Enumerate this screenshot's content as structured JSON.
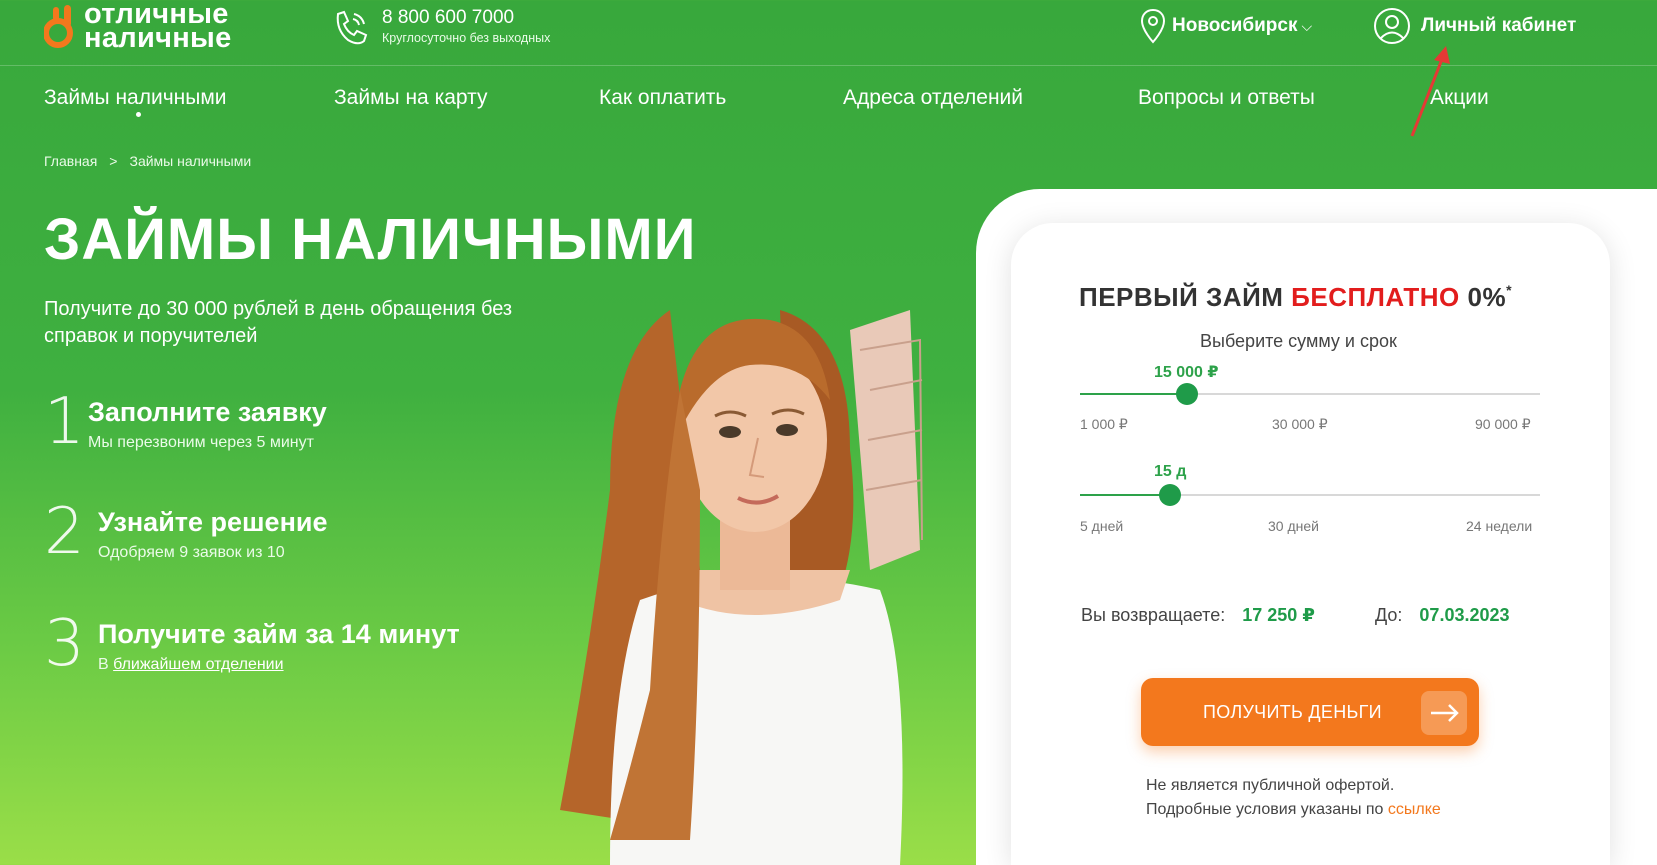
{
  "brand": {
    "line1": "отличные",
    "line2": "наличные"
  },
  "phone": {
    "number": "8 800 600 7000",
    "hours": "Круглосуточно без выходных"
  },
  "city": {
    "name": "Новосибирск",
    "icon": "location-pin-icon"
  },
  "cabinet": {
    "label": "Личный кабинет",
    "icon": "user-icon"
  },
  "nav": {
    "items": [
      {
        "label": "Займы наличными"
      },
      {
        "label": "Займы на карту"
      },
      {
        "label": "Как оплатить"
      },
      {
        "label": "Адреса отделений"
      },
      {
        "label": "Вопросы и ответы"
      },
      {
        "label": "Акции"
      }
    ]
  },
  "breadcrumb": {
    "home": "Главная",
    "sep": ">",
    "current": "Займы наличными"
  },
  "hero": {
    "title": "ЗАЙМЫ НАЛИЧНЫМИ",
    "subtitle": "Получите до 30 000 рублей в день обращения без справок и поручителей"
  },
  "steps": [
    {
      "num": "1",
      "title": "Заполните заявку",
      "desc": "Мы перезвоним через 5 минут"
    },
    {
      "num": "2",
      "title": "Узнайте решение",
      "desc": "Одобряем 9 заявок из 10"
    },
    {
      "num": "3",
      "title": "Получите займ за 14 минут",
      "desc_prefix": "В",
      "desc_link": "ближайшем отделении"
    }
  ],
  "calculator": {
    "title_prefix": "ПЕРВЫЙ ЗАЙМ",
    "title_red": "БЕСПЛАТНО",
    "title_suffix": "0%",
    "title_mark": "*",
    "subtitle": "Выберите сумму и срок",
    "amount": {
      "value": "15 000 ₽",
      "fraction": 0.233,
      "ticks": [
        "1 000 ₽",
        "30 000 ₽",
        "90 000 ₽"
      ]
    },
    "term": {
      "value": "15 д",
      "fraction": 0.195,
      "ticks": [
        "5 дней",
        "30 дней",
        "24 недели"
      ]
    },
    "return_label": "Вы возвращаете:",
    "return_value": "17 250 ₽",
    "due_label": "До:",
    "due_value": "07.03.2023",
    "cta": "ПОЛУЧИТЬ ДЕНЬГИ",
    "note_line1": "Не является публичной офертой.",
    "note_line2": "Подробные условия указаны по",
    "note_link": "ссылке"
  },
  "colors": {
    "green": "#38a83c",
    "accent_green": "#1f9b49",
    "orange": "#f3781d",
    "red": "#e21d1d"
  }
}
